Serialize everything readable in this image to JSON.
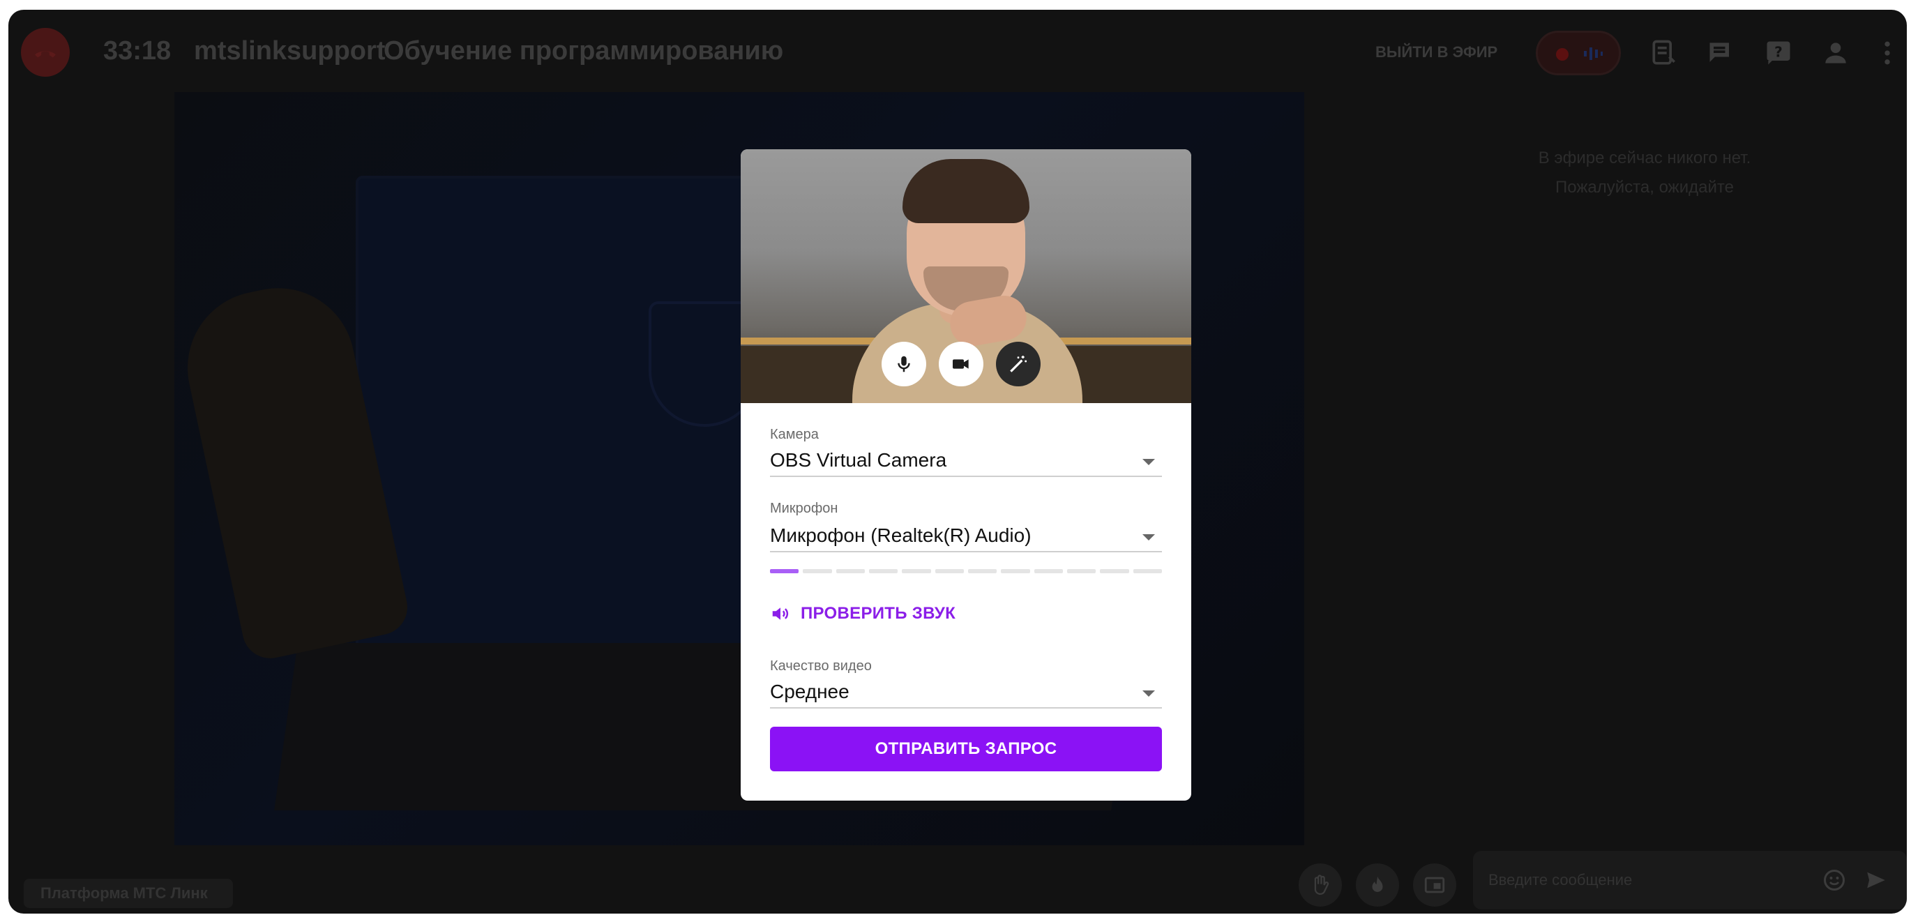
{
  "header": {
    "timer": "33:18",
    "host": "mtslinksupport",
    "title": "Обучение программированию",
    "go_live_label": "ВЫЙТИ В ЭФИР",
    "icons": [
      "end-call-icon",
      "record-icon",
      "audio-wave-icon",
      "notes-icon",
      "chat-icon",
      "question-icon",
      "participants-icon",
      "more-icon"
    ]
  },
  "side": {
    "empty_line1": "В эфире сейчас никого нет.",
    "empty_line2": "Пожалуйста, ожидайте"
  },
  "footer": {
    "platform": "Платформа МТС Линк",
    "chat_placeholder": "Введите сообщение",
    "icons": [
      "raise-hand-icon",
      "flame-icon",
      "picture-in-picture-icon",
      "emoji-icon",
      "send-icon"
    ]
  },
  "modal": {
    "preview_buttons": [
      "microphone-icon",
      "camera-icon",
      "magic-wand-icon"
    ],
    "camera_label": "Камера",
    "camera_value": "OBS Virtual Camera",
    "mic_label": "Микрофон",
    "mic_value": "Микрофон (Realtek(R) Audio)",
    "mic_level_segments": 12,
    "mic_level_active": 1,
    "check_sound": "ПРОВЕРИТЬ ЗВУК",
    "quality_label": "Качество видео",
    "quality_value": "Среднее",
    "submit": "ОТПРАВИТЬ ЗАПРОС"
  },
  "colors": {
    "accent": "#8b12f5",
    "accent_text": "#8b1ee8",
    "level_on": "#a95ff6",
    "background": "#121212"
  }
}
